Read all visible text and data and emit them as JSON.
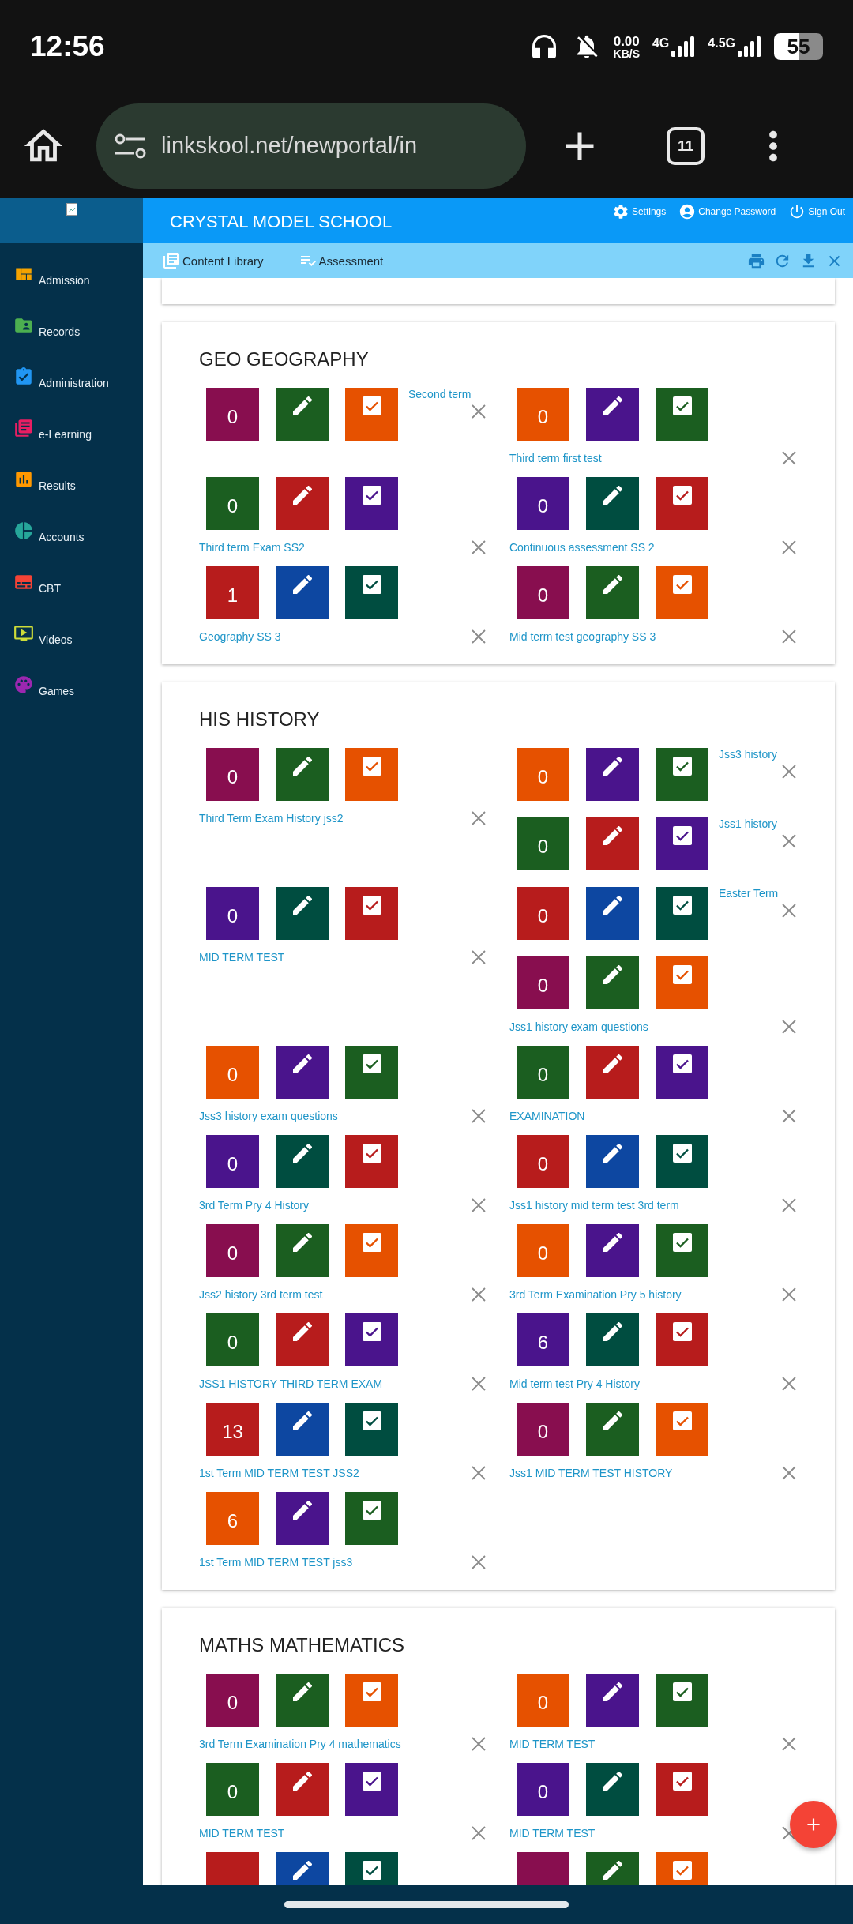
{
  "status_bar": {
    "time": "12:56",
    "net_speed": "0.00",
    "net_unit": "KB/S",
    "network_1": "4G",
    "network_2": "4.5G",
    "battery": "55"
  },
  "browser": {
    "url": "linkskool.net/newportal/in",
    "tab_count": "11"
  },
  "sidebar": {
    "items": [
      {
        "label": "Admission",
        "color": "#f5a300"
      },
      {
        "label": "Records",
        "color": "#4caf50"
      },
      {
        "label": "Administration",
        "color": "#2196f3"
      },
      {
        "label": "e-Learning",
        "color": "#e91e63"
      },
      {
        "label": "Results",
        "color": "#ff9800"
      },
      {
        "label": "Accounts",
        "color": "#26a69a"
      },
      {
        "label": "CBT",
        "color": "#f44336"
      },
      {
        "label": "Videos",
        "color": "#cddc39"
      },
      {
        "label": "Games",
        "color": "#9c27b0"
      }
    ]
  },
  "header": {
    "title": "CRYSTAL MODEL SCHOOL",
    "actions": [
      "Settings",
      "Change Password",
      "Sign Out"
    ]
  },
  "toolbar": {
    "tabs": [
      "Content Library",
      "Assessment"
    ]
  },
  "sections": [
    {
      "title": "GEO GEOGRAPHY",
      "rows": [
        {
          "left": [
            {
              "kind": "side",
              "label": "Second term",
              "count": "0",
              "tiles": [
                {
                  "color": "#880e4f"
                },
                {
                  "color": "#1b5e20"
                },
                {
                  "color": "#e65100"
                }
              ]
            }
          ],
          "right": [
            {
              "kind": "below",
              "label": "Third term first test",
              "count": "0",
              "tiles": [
                {
                  "color": "#e65100"
                },
                {
                  "color": "#4a148c"
                },
                {
                  "color": "#1b5e20"
                }
              ]
            }
          ]
        },
        {
          "left": [
            {
              "kind": "below",
              "label": "Third term Exam SS2",
              "count": "0",
              "tiles": [
                {
                  "color": "#1b5e20"
                },
                {
                  "color": "#b71c1c"
                },
                {
                  "color": "#4a148c"
                }
              ]
            }
          ],
          "right": [
            {
              "kind": "below",
              "label": "Continuous assessment SS 2",
              "count": "0",
              "tiles": [
                {
                  "color": "#4a148c"
                },
                {
                  "color": "#004d40"
                },
                {
                  "color": "#b71c1c"
                }
              ]
            }
          ]
        },
        {
          "left": [
            {
              "kind": "below",
              "label": "Geography SS 3",
              "count": "1",
              "tiles": [
                {
                  "color": "#b71c1c"
                },
                {
                  "color": "#0d47a1"
                },
                {
                  "color": "#004d40"
                }
              ]
            }
          ],
          "right": [
            {
              "kind": "below",
              "label": "Mid term test geography SS 3",
              "count": "0",
              "tiles": [
                {
                  "color": "#880e4f"
                },
                {
                  "color": "#1b5e20"
                },
                {
                  "color": "#e65100"
                }
              ]
            }
          ]
        }
      ]
    },
    {
      "title": "HIS HISTORY",
      "rows": [
        {
          "left": [
            {
              "kind": "below",
              "label": "Third Term Exam History jss2",
              "count": "0",
              "tiles": [
                {
                  "color": "#880e4f"
                },
                {
                  "color": "#1b5e20"
                },
                {
                  "color": "#e65100"
                }
              ]
            }
          ],
          "right": [
            {
              "kind": "side",
              "label": "Jss3 history",
              "count": "0",
              "tiles": [
                {
                  "color": "#e65100"
                },
                {
                  "color": "#4a148c"
                },
                {
                  "color": "#1b5e20"
                }
              ]
            },
            {
              "kind": "side",
              "label": "Jss1 history",
              "count": "0",
              "tiles": [
                {
                  "color": "#1b5e20"
                },
                {
                  "color": "#b71c1c"
                },
                {
                  "color": "#4a148c"
                }
              ]
            }
          ]
        },
        {
          "left": [
            {
              "kind": "below",
              "label": "MID TERM TEST",
              "count": "0",
              "tiles": [
                {
                  "color": "#4a148c"
                },
                {
                  "color": "#004d40"
                },
                {
                  "color": "#b71c1c"
                }
              ]
            }
          ],
          "right": [
            {
              "kind": "side",
              "label": "Easter Term",
              "count": "0",
              "tiles": [
                {
                  "color": "#b71c1c"
                },
                {
                  "color": "#0d47a1"
                },
                {
                  "color": "#004d40"
                }
              ]
            },
            {
              "kind": "below",
              "label": "Jss1 history exam questions",
              "count": "0",
              "tiles": [
                {
                  "color": "#880e4f"
                },
                {
                  "color": "#1b5e20"
                },
                {
                  "color": "#e65100"
                }
              ]
            }
          ]
        },
        {
          "left": [
            {
              "kind": "below",
              "label": "Jss3 history exam questions",
              "count": "0",
              "tiles": [
                {
                  "color": "#e65100"
                },
                {
                  "color": "#4a148c"
                },
                {
                  "color": "#1b5e20"
                }
              ]
            }
          ],
          "right": [
            {
              "kind": "below",
              "label": "EXAMINATION",
              "count": "0",
              "tiles": [
                {
                  "color": "#1b5e20"
                },
                {
                  "color": "#b71c1c"
                },
                {
                  "color": "#4a148c"
                }
              ]
            }
          ]
        },
        {
          "left": [
            {
              "kind": "below",
              "label": "3rd Term Pry 4 History",
              "count": "0",
              "tiles": [
                {
                  "color": "#4a148c"
                },
                {
                  "color": "#004d40"
                },
                {
                  "color": "#b71c1c"
                }
              ]
            }
          ],
          "right": [
            {
              "kind": "below",
              "label": "Jss1 history mid term test 3rd term",
              "count": "0",
              "tiles": [
                {
                  "color": "#b71c1c"
                },
                {
                  "color": "#0d47a1"
                },
                {
                  "color": "#004d40"
                }
              ]
            }
          ]
        },
        {
          "left": [
            {
              "kind": "below",
              "label": "Jss2 history 3rd term test",
              "count": "0",
              "tiles": [
                {
                  "color": "#880e4f"
                },
                {
                  "color": "#1b5e20"
                },
                {
                  "color": "#e65100"
                }
              ]
            }
          ],
          "right": [
            {
              "kind": "below",
              "label": "3rd Term Examination Pry 5 history",
              "count": "0",
              "tiles": [
                {
                  "color": "#e65100"
                },
                {
                  "color": "#4a148c"
                },
                {
                  "color": "#1b5e20"
                }
              ]
            }
          ]
        },
        {
          "left": [
            {
              "kind": "below",
              "label": "JSS1 HISTORY THIRD TERM EXAM",
              "count": "0",
              "tiles": [
                {
                  "color": "#1b5e20"
                },
                {
                  "color": "#b71c1c"
                },
                {
                  "color": "#4a148c"
                }
              ]
            }
          ],
          "right": [
            {
              "kind": "below",
              "label": "Mid term test Pry 4 History",
              "count": "6",
              "tiles": [
                {
                  "color": "#4a148c"
                },
                {
                  "color": "#004d40"
                },
                {
                  "color": "#b71c1c"
                }
              ]
            }
          ]
        },
        {
          "left": [
            {
              "kind": "below",
              "label": "1st Term MID TERM TEST JSS2",
              "count": "13",
              "tiles": [
                {
                  "color": "#b71c1c"
                },
                {
                  "color": "#0d47a1"
                },
                {
                  "color": "#004d40"
                }
              ]
            }
          ],
          "right": [
            {
              "kind": "below",
              "label": "Jss1 MID TERM TEST HISTORY",
              "count": "0",
              "tiles": [
                {
                  "color": "#880e4f"
                },
                {
                  "color": "#1b5e20"
                },
                {
                  "color": "#e65100"
                }
              ]
            }
          ]
        },
        {
          "left": [
            {
              "kind": "below",
              "label": "1st Term MID TERM TEST jss3",
              "count": "6",
              "tiles": [
                {
                  "color": "#e65100"
                },
                {
                  "color": "#4a148c"
                },
                {
                  "color": "#1b5e20"
                }
              ]
            }
          ],
          "right": []
        }
      ]
    },
    {
      "title": "MATHS MATHEMATICS",
      "rows": [
        {
          "left": [
            {
              "kind": "below",
              "label": "3rd Term Examination Pry 4 mathematics",
              "count": "0",
              "tiles": [
                {
                  "color": "#880e4f"
                },
                {
                  "color": "#1b5e20"
                },
                {
                  "color": "#e65100"
                }
              ]
            }
          ],
          "right": [
            {
              "kind": "below",
              "label": "MID TERM TEST",
              "count": "0",
              "tiles": [
                {
                  "color": "#e65100"
                },
                {
                  "color": "#4a148c"
                },
                {
                  "color": "#1b5e20"
                }
              ]
            }
          ]
        },
        {
          "left": [
            {
              "kind": "below",
              "label": "MID TERM TEST",
              "count": "0",
              "tiles": [
                {
                  "color": "#1b5e20"
                },
                {
                  "color": "#b71c1c"
                },
                {
                  "color": "#4a148c"
                }
              ]
            }
          ],
          "right": [
            {
              "kind": "below",
              "label": "MID TERM TEST",
              "count": "0",
              "tiles": [
                {
                  "color": "#4a148c"
                },
                {
                  "color": "#004d40"
                },
                {
                  "color": "#b71c1c"
                }
              ]
            }
          ]
        },
        {
          "left": [
            {
              "kind": "cut",
              "tiles": [
                {
                  "color": "#b71c1c"
                },
                {
                  "color": "#0d47a1"
                },
                {
                  "color": "#004d40"
                }
              ]
            }
          ],
          "right": [
            {
              "kind": "cut",
              "tiles": [
                {
                  "color": "#880e4f"
                },
                {
                  "color": "#1b5e20"
                },
                {
                  "color": "#e65100"
                }
              ]
            }
          ]
        }
      ]
    }
  ]
}
